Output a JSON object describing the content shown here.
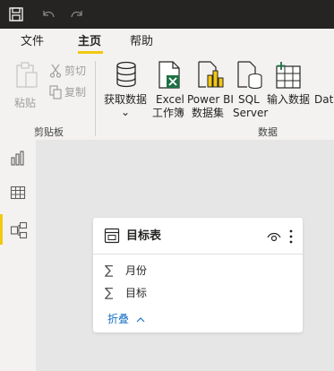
{
  "quick_access": {
    "save_icon": "save-icon",
    "undo_icon": "undo-icon",
    "redo_icon": "redo-icon"
  },
  "tabs": [
    {
      "label": "文件",
      "active": false
    },
    {
      "label": "主页",
      "active": true
    },
    {
      "label": "帮助",
      "active": false
    }
  ],
  "ribbon": {
    "clipboard": {
      "group_label": "剪贴板",
      "paste_label": "粘贴",
      "cut_label": "剪切",
      "copy_label": "复制"
    },
    "data": {
      "group_label": "数据",
      "get_data_label": "获取数据",
      "get_data_chevron": "⌄",
      "excel_line1": "Excel",
      "excel_line2": "工作簿",
      "pbi_line1": "Power BI",
      "pbi_line2": "数据集",
      "sql_line1": "SQL",
      "sql_line2": "Server",
      "enter_data_label": "输入数据",
      "dataverse_label": "Data"
    }
  },
  "nav": {
    "items": [
      {
        "name": "report-view",
        "icon": "bar-chart-icon",
        "active": false
      },
      {
        "name": "data-view",
        "icon": "table-grid-icon",
        "active": false
      },
      {
        "name": "model-view",
        "icon": "model-icon",
        "active": true
      }
    ]
  },
  "table_card": {
    "title": "目标表",
    "fields": [
      {
        "symbol": "∑",
        "name": "月份"
      },
      {
        "symbol": "∑",
        "name": "目标"
      }
    ],
    "collapse_label": "折叠",
    "collapse_chevron": "^"
  },
  "colors": {
    "accent": "#f2c811",
    "titlebar": "#252423",
    "ribbon_bg": "#f3f2f1",
    "canvas_bg": "#e6e6e6",
    "link": "#1a73c8",
    "excel_green": "#1e7145"
  }
}
